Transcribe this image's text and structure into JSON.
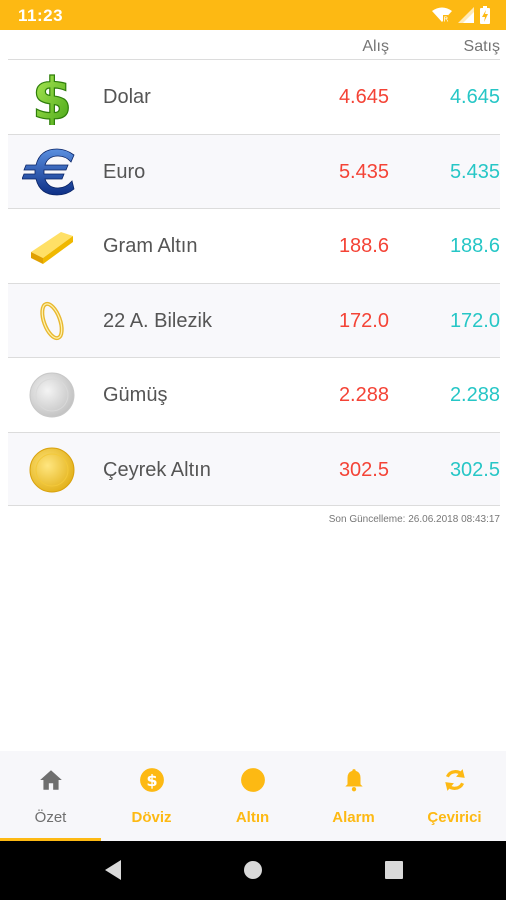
{
  "status_bar": {
    "time": "11:23"
  },
  "header": {
    "buy_label": "Alış",
    "sell_label": "Satış"
  },
  "rates": [
    {
      "name": "Dolar",
      "buy": "4.645",
      "sell": "4.645",
      "icon": "dollar-icon"
    },
    {
      "name": "Euro",
      "buy": "5.435",
      "sell": "5.435",
      "icon": "euro-icon"
    },
    {
      "name": "Gram Altın",
      "buy": "188.6",
      "sell": "188.6",
      "icon": "gold-bar-icon"
    },
    {
      "name": "22 A. Bilezik",
      "buy": "172.0",
      "sell": "172.0",
      "icon": "bracelet-icon"
    },
    {
      "name": "Gümüş",
      "buy": "2.288",
      "sell": "2.288",
      "icon": "silver-coin-icon"
    },
    {
      "name": "Çeyrek Altın",
      "buy": "302.5",
      "sell": "302.5",
      "icon": "gold-coin-icon"
    }
  ],
  "last_update": "Son Güncelleme: 26.06.2018 08:43:17",
  "bottom_nav": [
    {
      "label": "Özet",
      "icon": "home-icon",
      "active": true
    },
    {
      "label": "Döviz",
      "icon": "dollar-circle-icon",
      "active": false
    },
    {
      "label": "Altın",
      "icon": "gold-circle-icon",
      "active": false
    },
    {
      "label": "Alarm",
      "icon": "bell-icon",
      "active": false
    },
    {
      "label": "Çevirici",
      "icon": "refresh-icon",
      "active": false
    }
  ],
  "colors": {
    "accent": "#fdb913",
    "buy": "#f44336",
    "sell": "#26c6c6"
  }
}
